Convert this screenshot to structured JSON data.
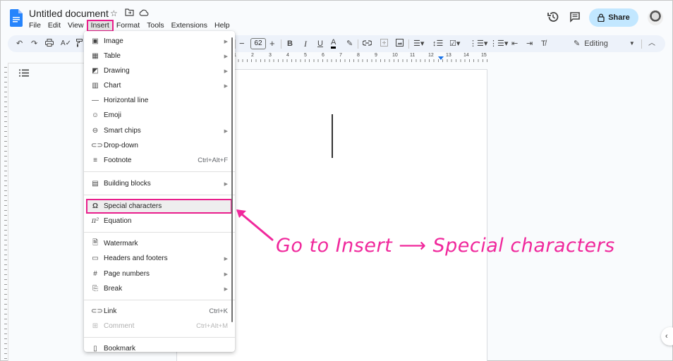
{
  "header": {
    "title": "Untitled document",
    "menu": [
      "File",
      "Edit",
      "View",
      "Insert",
      "Format",
      "Tools",
      "Extensions",
      "Help"
    ],
    "active_menu": "Insert",
    "share_label": "Share"
  },
  "toolbar": {
    "font_size": "62",
    "minus": "−",
    "plus": "+",
    "bold": "B",
    "italic": "I",
    "underline": "U",
    "text_color": "A",
    "mode_label": "Editing"
  },
  "ruler": {
    "numbers": [
      "1",
      "2",
      "3",
      "4",
      "5",
      "6",
      "7",
      "8",
      "9",
      "10",
      "11",
      "12",
      "13",
      "14",
      "15"
    ]
  },
  "insert_menu": {
    "items": [
      {
        "label": "Image",
        "icon": "image-icon",
        "submenu": true
      },
      {
        "label": "Table",
        "icon": "table-icon",
        "submenu": true
      },
      {
        "label": "Drawing",
        "icon": "drawing-icon",
        "submenu": true
      },
      {
        "label": "Chart",
        "icon": "chart-icon",
        "submenu": true
      },
      {
        "label": "Horizontal line",
        "icon": "horizontal-line-icon"
      },
      {
        "label": "Emoji",
        "icon": "emoji-icon"
      },
      {
        "label": "Smart chips",
        "icon": "smart-chips-icon",
        "submenu": true
      },
      {
        "label": "Drop-down",
        "icon": "dropdown-icon"
      },
      {
        "label": "Footnote",
        "icon": "footnote-icon",
        "shortcut": "Ctrl+Alt+F"
      },
      {
        "label": "Building blocks",
        "icon": "building-blocks-icon",
        "submenu": true
      },
      {
        "label": "Special characters",
        "icon": "omega-icon",
        "highlighted": true
      },
      {
        "label": "Equation",
        "icon": "pi-icon"
      },
      {
        "label": "Watermark",
        "icon": "watermark-icon"
      },
      {
        "label": "Headers and footers",
        "icon": "headers-footers-icon",
        "submenu": true
      },
      {
        "label": "Page numbers",
        "icon": "hash-icon",
        "submenu": true
      },
      {
        "label": "Break",
        "icon": "break-icon",
        "submenu": true
      },
      {
        "label": "Link",
        "icon": "link-icon",
        "shortcut": "Ctrl+K"
      },
      {
        "label": "Comment",
        "icon": "comment-icon",
        "shortcut": "Ctrl+Alt+M",
        "disabled": true
      },
      {
        "label": "Bookmark",
        "icon": "bookmark-icon"
      }
    ]
  },
  "annotation": {
    "text": "Go to Insert ⟶ Special characters",
    "color": "#f0289c"
  },
  "colors": {
    "accent": "#e91e8c",
    "share_bg": "#c2e7ff",
    "toolbar_bg": "#edf2fa"
  }
}
